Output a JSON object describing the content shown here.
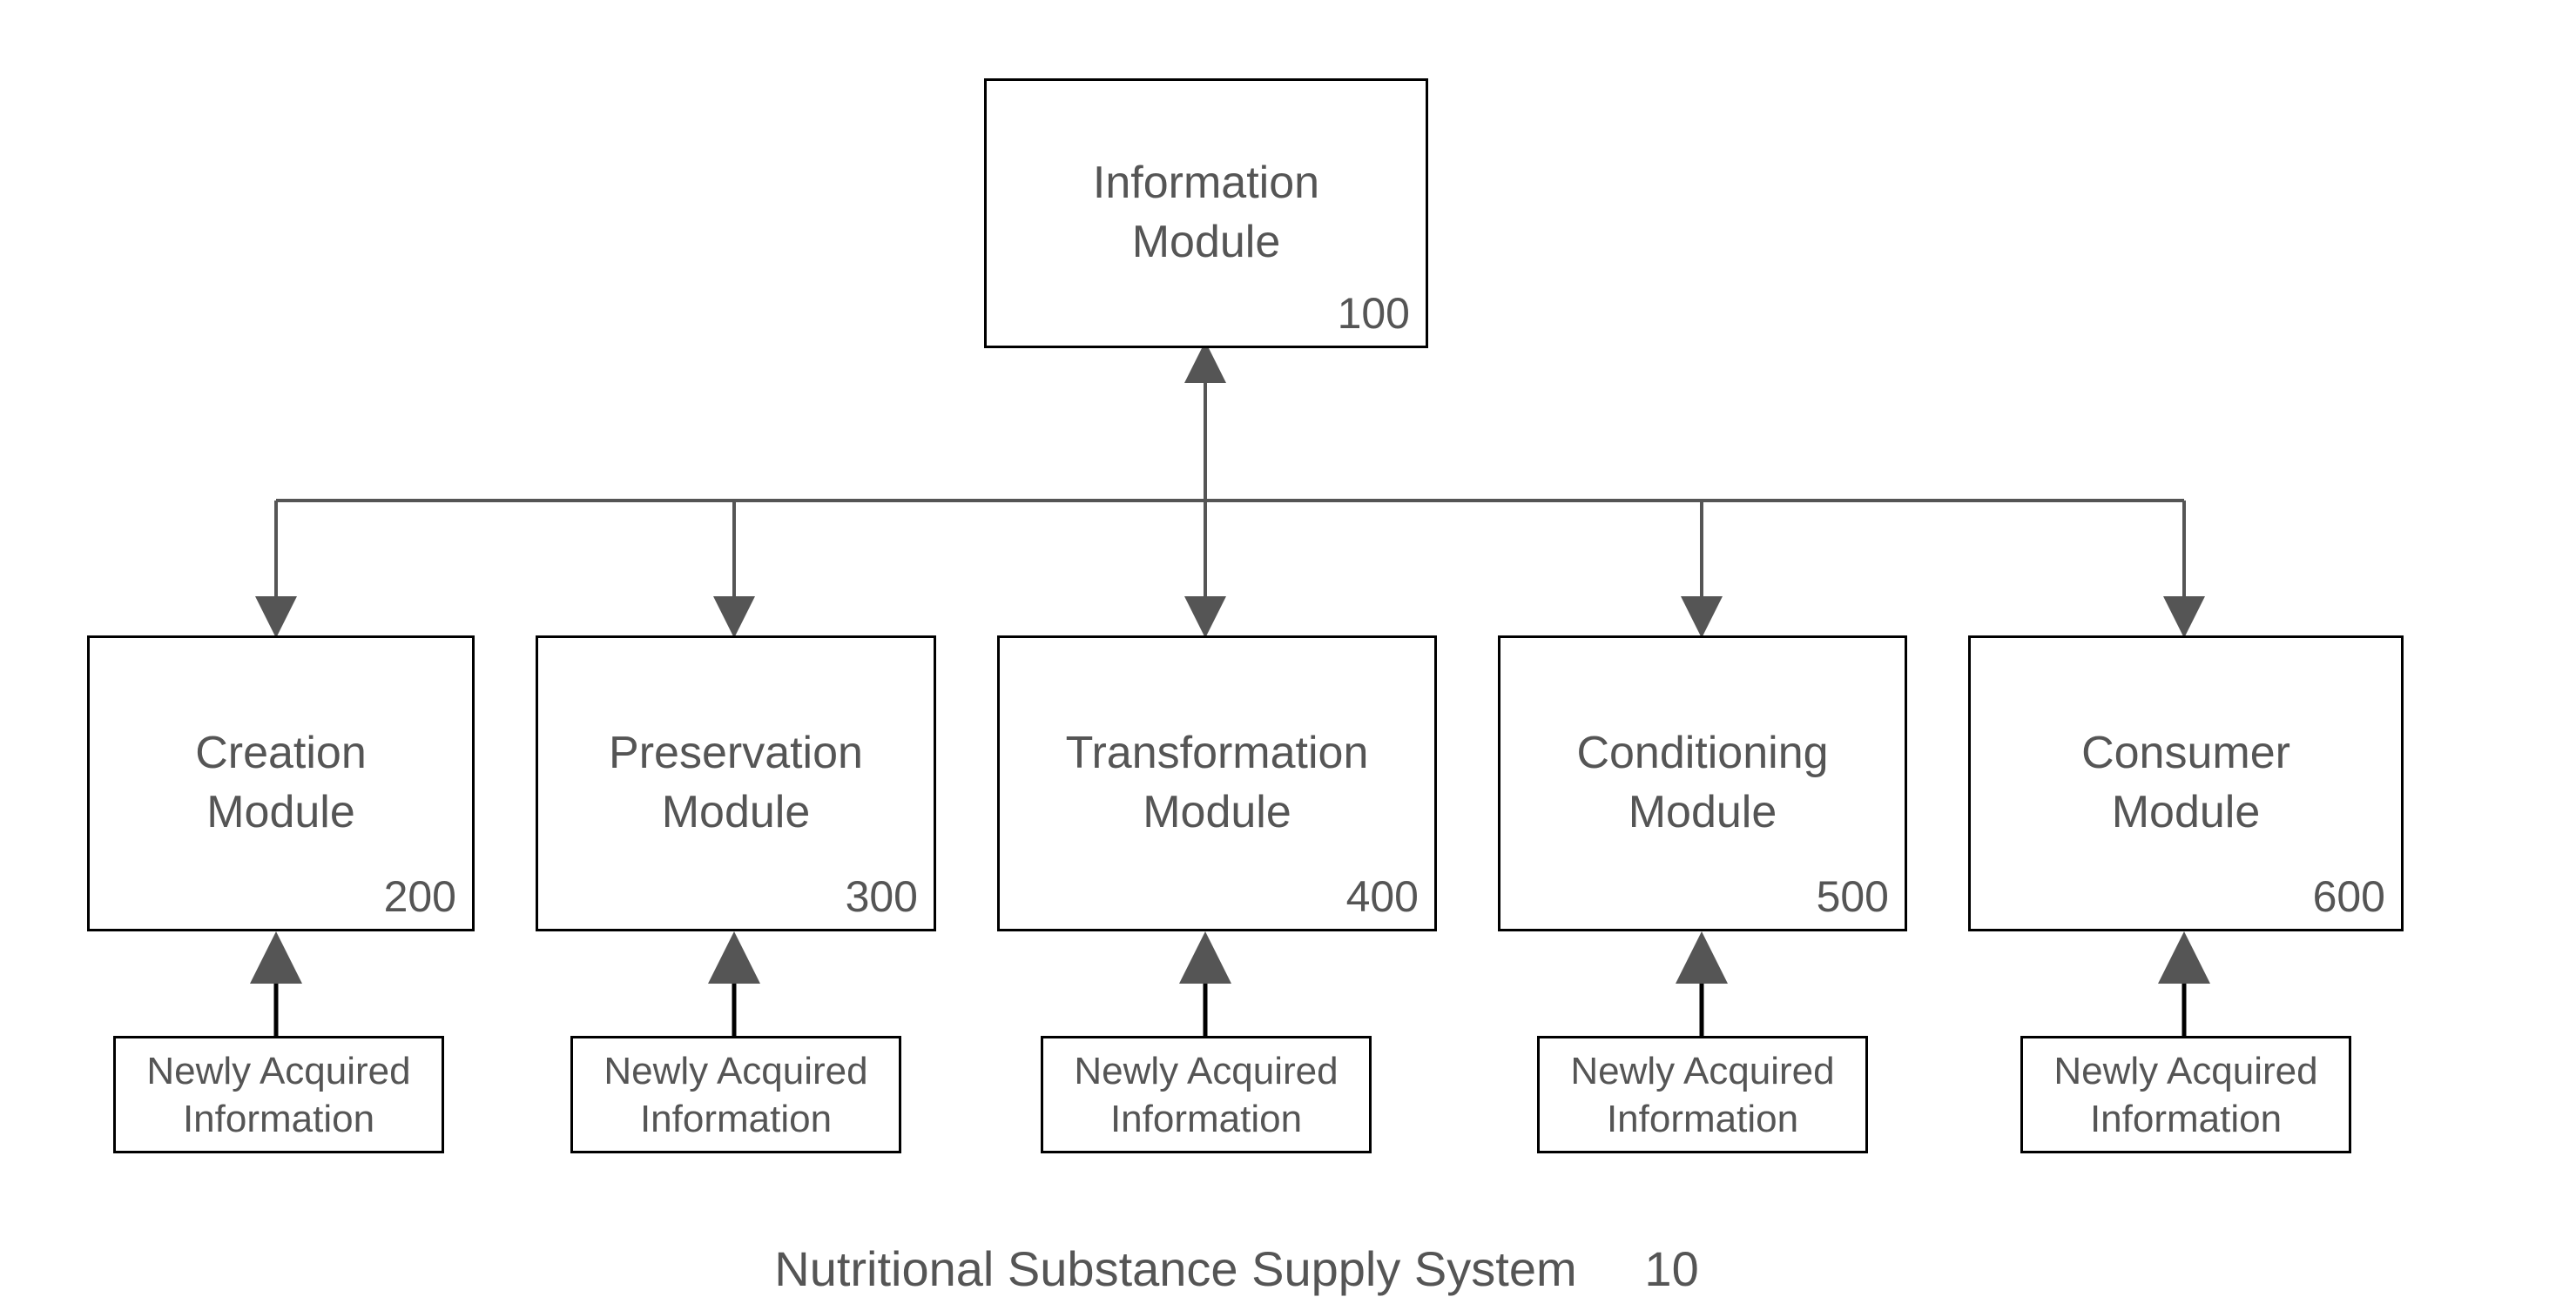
{
  "top_box": {
    "line1": "Information",
    "line2": "Module",
    "number": "100"
  },
  "modules": [
    {
      "line1": "Creation",
      "line2": "Module",
      "number": "200"
    },
    {
      "line1": "Preservation",
      "line2": "Module",
      "number": "300"
    },
    {
      "line1": "Transformation",
      "line2": "Module",
      "number": "400"
    },
    {
      "line1": "Conditioning",
      "line2": "Module",
      "number": "500"
    },
    {
      "line1": "Consumer",
      "line2": "Module",
      "number": "600"
    }
  ],
  "info_boxes": [
    {
      "line1": "Newly Acquired",
      "line2": "Information"
    },
    {
      "line1": "Newly Acquired",
      "line2": "Information"
    },
    {
      "line1": "Newly Acquired",
      "line2": "Information"
    },
    {
      "line1": "Newly Acquired",
      "line2": "Information"
    },
    {
      "line1": "Newly Acquired",
      "line2": "Information"
    }
  ],
  "caption": {
    "text": "Nutritional Substance Supply System",
    "number": "10"
  }
}
